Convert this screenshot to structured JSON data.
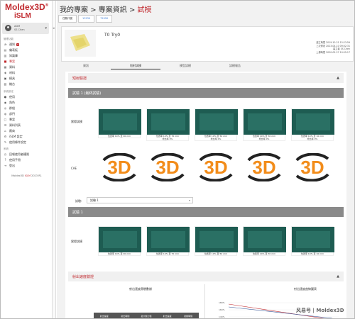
{
  "brand": {
    "title": "Moldex3D",
    "mark": "®",
    "product": "iSLM"
  },
  "user": {
    "name": "ADM",
    "sub": "SS Chen"
  },
  "sidebar": {
    "section1": "管理功能",
    "items": [
      {
        "label": "通知",
        "icon": "bell-icon",
        "badge": "3"
      },
      {
        "label": "儀表板",
        "icon": "dashboard-icon"
      },
      {
        "label": "知識庫",
        "icon": "book-icon"
      },
      {
        "label": "專案",
        "icon": "folder-icon",
        "active": true
      },
      {
        "label": "資料",
        "icon": "data-icon"
      },
      {
        "label": "材料",
        "icon": "material-icon"
      },
      {
        "label": "模具",
        "icon": "mold-icon"
      },
      {
        "label": "機台",
        "icon": "machine-icon"
      }
    ],
    "section2": "系統設定",
    "items2": [
      {
        "label": "使用",
        "icon": "user-icon"
      },
      {
        "label": "角色",
        "icon": "role-icon"
      },
      {
        "label": "群組",
        "icon": "group-icon"
      },
      {
        "label": "部門",
        "icon": "dept-icon"
      },
      {
        "label": "專案",
        "icon": "project-icon"
      },
      {
        "label": "資料列表",
        "icon": "list-icon"
      },
      {
        "label": "廠商",
        "icon": "vendor-icon"
      },
      {
        "label": "iSLM 設定",
        "icon": "settings-icon"
      },
      {
        "label": "使用條件設定",
        "icon": "terms-icon"
      }
    ],
    "section3": "系統",
    "items3": [
      {
        "label": "回報使用者權限",
        "icon": "report-icon"
      },
      {
        "label": "使用手冊",
        "icon": "manual-icon"
      },
      {
        "label": "登出",
        "icon": "logout-icon"
      }
    ],
    "footer": {
      "prefix": "Moldex3D",
      "mid": "iSLM",
      "suffix": "2023 R1"
    }
  },
  "breadcrumb": {
    "a": "我的專案",
    "sep": ">",
    "b": "專案資訊",
    "c": "試模"
  },
  "chips": [
    "任務代號",
    "13230",
    "72950"
  ],
  "info": {
    "title": "T0 Try0",
    "meta": [
      "建立時間 2019-10-21 15:23:59",
      "上次修改 2023-04-10 09:02:31",
      "建立者 SS Chen",
      "上傳時間 2020-05-27 10:55:17"
    ]
  },
  "tabs": [
    "資訊",
    "短射試模",
    "模型試模",
    "試模報告"
  ],
  "section1": {
    "title": "短射驗證",
    "caret": "▲"
  },
  "trial1": {
    "title": "試驗 1 (最終試驗)"
  },
  "row_labels": {
    "actual": "實際試模",
    "cae": "CAE"
  },
  "cards": [
    {
      "line1": "位置率 10% 至 90 mm",
      "line2": ""
    },
    {
      "line1": "位置率 10% 至 70 mm",
      "line2": "增比率 0%"
    },
    {
      "line1": "位置率 10% 至 50 mm",
      "line2": "增比率 0%"
    },
    {
      "line1": "位置率 10% 至 30 mm",
      "line2": "增比率 0%"
    },
    {
      "line1": "位置率 10% 至 10 mm",
      "line2": "增比率 0%"
    }
  ],
  "cae_label": "3D",
  "select": {
    "label": "試驗:",
    "value": "試驗 1"
  },
  "trial2": {
    "title": "試驗 1"
  },
  "cards2": [
    {
      "line1": "位置率 10% 至 90 mm"
    },
    {
      "line1": "位置率 10% 至 70 mm"
    },
    {
      "line1": "位置率 10% 至 50 mm"
    },
    {
      "line1": "位置率 10% 至 30 mm"
    },
    {
      "line1": "位置率 10% 至 10 mm"
    }
  ],
  "section2": {
    "title": "射出速度驗證",
    "caret": "▲"
  },
  "sub_left": "射出速度實驗數據",
  "sub_right": "射出速度曲線圖表",
  "table_headers": [
    "射出速度",
    "射出時間",
    "最大壓力值",
    "射出速度",
    "射壓時間"
  ],
  "chart_ticks": [
    "180%",
    "160%",
    "140%"
  ],
  "watermark": "风易号 | Moldex3D"
}
